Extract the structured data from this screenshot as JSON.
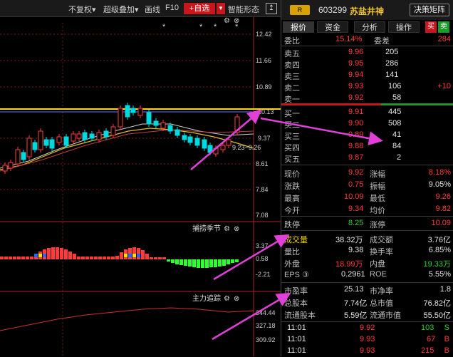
{
  "toolbar": {
    "items": [
      "不复权▾",
      "超级叠加▾",
      "画线",
      "F10"
    ],
    "add_label": "+自选",
    "drop": "▼",
    "smart_label": "智能形态",
    "expand_icon": "↥"
  },
  "stock": {
    "badge": "R",
    "code": "603299",
    "name": "苏盐井神",
    "decision_btn": "决策矩阵"
  },
  "tabs": [
    "报价",
    "资金",
    "分析",
    "操作"
  ],
  "buy_label": "买",
  "sell_label": "卖",
  "weibi": {
    "label": "委比",
    "value": "15.14%",
    "label2": "委差",
    "value2": "284"
  },
  "asks": [
    {
      "label": "卖五",
      "price": "9.96",
      "vol": "205",
      "chg": ""
    },
    {
      "label": "卖四",
      "price": "9.95",
      "vol": "286",
      "chg": ""
    },
    {
      "label": "卖三",
      "price": "9.94",
      "vol": "141",
      "chg": ""
    },
    {
      "label": "卖二",
      "price": "9.93",
      "vol": "106",
      "chg": "+10"
    },
    {
      "label": "卖一",
      "price": "9.92",
      "vol": "58",
      "chg": ""
    }
  ],
  "bids": [
    {
      "label": "买一",
      "price": "9.91",
      "vol": "445"
    },
    {
      "label": "买二",
      "price": "9.90",
      "vol": "508"
    },
    {
      "label": "买三",
      "price": "9.89",
      "vol": "41"
    },
    {
      "label": "买四",
      "price": "9.88",
      "vol": "84"
    },
    {
      "label": "买五",
      "price": "9.87",
      "vol": "2"
    }
  ],
  "quote": [
    {
      "l1": "现价",
      "v1": "9.92",
      "c1": "red",
      "l2": "涨幅",
      "v2": "8.18%",
      "c2": "red"
    },
    {
      "l1": "涨跌",
      "v1": "0.75",
      "c1": "red",
      "l2": "振幅",
      "v2": "9.05%",
      "c2": "white"
    },
    {
      "l1": "最高",
      "v1": "10.09",
      "c1": "red",
      "l2": "最低",
      "v2": "9.26",
      "c2": "red"
    },
    {
      "l1": "今开",
      "v1": "9.34",
      "c1": "red",
      "l2": "均价",
      "v2": "9.82",
      "c2": "red"
    }
  ],
  "limit": {
    "l1": "跌停",
    "v1": "8.25",
    "l2": "涨停",
    "v2": "10.09"
  },
  "volume": [
    {
      "l1": "成交量",
      "v1": "38.32万",
      "c1": "white",
      "l2": "成交额",
      "v2": "3.76亿",
      "c2": "white"
    },
    {
      "l1": "量比",
      "v1": "9.38",
      "c1": "white",
      "l2": "换手率",
      "v2": "6.85%",
      "c2": "white"
    },
    {
      "l1": "外盘",
      "v1": "18.99万",
      "c1": "red",
      "l2": "内盘",
      "v2": "19.33万",
      "c2": "green"
    },
    {
      "l1": "EPS ③",
      "v1": "0.2961",
      "c1": "white",
      "l2": "ROE",
      "v2": "5.55%",
      "c2": "white"
    }
  ],
  "valuation": [
    {
      "l1": "市盈率",
      "v1": "25.13",
      "l2": "市净率",
      "v2": "1.8"
    },
    {
      "l1": "总股本",
      "v1": "7.74亿",
      "l2": "总市值",
      "v2": "76.82亿"
    },
    {
      "l1": "流通股本",
      "v1": "5.59亿",
      "l2": "流通市值",
      "v2": "55.50亿"
    }
  ],
  "trades": [
    {
      "time": "11:01",
      "price": "9.92",
      "vol": "103",
      "side": "S",
      "color": "green"
    },
    {
      "time": "11:01",
      "price": "9.93",
      "vol": "67",
      "side": "B",
      "color": "red"
    },
    {
      "time": "11:01",
      "price": "9.93",
      "vol": "215",
      "side": "B",
      "color": "red"
    }
  ],
  "main_chart": {
    "yticks": [
      "12.42",
      "11.66",
      "10.89",
      "10.13",
      "9.37",
      "8.61",
      "7.84",
      "7.08"
    ],
    "range_label": "9.23~9.26",
    "stars": [
      "*",
      "*",
      "*",
      "*"
    ]
  },
  "ind1": {
    "name": "捕捞季节",
    "ticks": [
      "3.37",
      "0.58",
      "-2.21"
    ]
  },
  "ind2": {
    "name": "主力追踪",
    "ticks": [
      "344.44",
      "327.18",
      "309.92"
    ]
  },
  "panel_icons": {
    "gear": "⚙",
    "close": "⊗"
  },
  "colors": {
    "up": "#ff3b3b",
    "down": "#00c8c8",
    "grid": "#7a1f1f",
    "highlight": "#ffd800",
    "arrow": "#e040d8"
  }
}
